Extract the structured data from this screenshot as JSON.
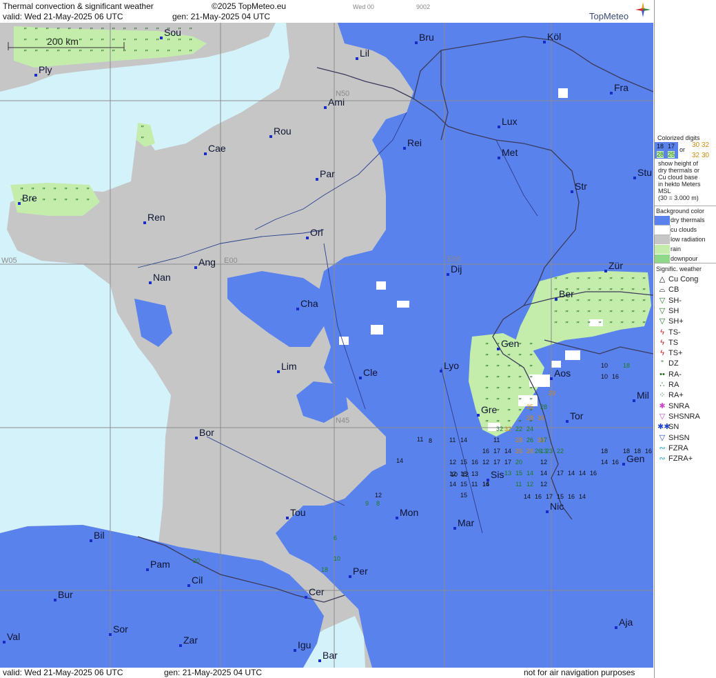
{
  "header": {
    "product_title": "Thermal convection & significant weather",
    "copyright": "©2025 TopMeteo.eu",
    "valid_line": "valid:  Wed  21-May-2025  06 UTC",
    "gen_line": "gen: 21-May-2025 04 UTC",
    "small_code_a": "Wed 00",
    "small_code_b": "9002",
    "brand": "TopMeteo"
  },
  "footer": {
    "valid_line": "valid:  Wed  21-May-2025  06 UTC",
    "gen_line": "gen: 21-May-2025 04 UTC",
    "disclaimer": "not for air navigation purposes"
  },
  "map": {
    "scale_label": "200 km",
    "grid_labels": [
      "N50",
      "N45",
      "W05",
      "E00",
      "E05"
    ],
    "colors": {
      "sea": "#d4f2fa",
      "dry_thermals": "#5a82ec",
      "low_radiation": "#c6c6c6",
      "rain": "#c4edac",
      "cu_clouds": "#ffffff",
      "downpour": "#8fd88a",
      "border": "#3a3a5a",
      "river": "#2b3f8c",
      "grid": "#8c8c8c"
    },
    "cities": [
      {
        "name": "Sou"
      },
      {
        "name": "Ply"
      },
      {
        "name": "Lil"
      },
      {
        "name": "Bru"
      },
      {
        "name": "Köl"
      },
      {
        "name": "Ami"
      },
      {
        "name": "Fra"
      },
      {
        "name": "Rou"
      },
      {
        "name": "Lux"
      },
      {
        "name": "Cae"
      },
      {
        "name": "Rei"
      },
      {
        "name": "Met"
      },
      {
        "name": "Par"
      },
      {
        "name": "Stu"
      },
      {
        "name": "Bre"
      },
      {
        "name": "Str"
      },
      {
        "name": "Ren"
      },
      {
        "name": "Orl"
      },
      {
        "name": "Ang"
      },
      {
        "name": "Dij"
      },
      {
        "name": "Zür"
      },
      {
        "name": "Nan"
      },
      {
        "name": "Ber"
      },
      {
        "name": "Cha"
      },
      {
        "name": "Gen"
      },
      {
        "name": "Lim"
      },
      {
        "name": "Cle"
      },
      {
        "name": "Lyo"
      },
      {
        "name": "Aos"
      },
      {
        "name": "Mil"
      },
      {
        "name": "Gre"
      },
      {
        "name": "Tor"
      },
      {
        "name": "Bor"
      },
      {
        "name": "Gen"
      },
      {
        "name": "Sis"
      },
      {
        "name": "Tou"
      },
      {
        "name": "Mon"
      },
      {
        "name": "Nic"
      },
      {
        "name": "Mar"
      },
      {
        "name": "Bil"
      },
      {
        "name": "Per"
      },
      {
        "name": "Pam"
      },
      {
        "name": "Cil"
      },
      {
        "name": "Cer"
      },
      {
        "name": "Bur"
      },
      {
        "name": "Sor"
      },
      {
        "name": "Aja"
      },
      {
        "name": "Val"
      },
      {
        "name": "Zar"
      },
      {
        "name": "Igu"
      },
      {
        "name": "Bar"
      }
    ],
    "height_digits": [
      {
        "v": "11"
      },
      {
        "v": "8"
      },
      {
        "v": "14"
      },
      {
        "v": "11"
      },
      {
        "v": "14"
      },
      {
        "v": "12"
      },
      {
        "v": "15"
      },
      {
        "v": "16"
      },
      {
        "v": "12"
      },
      {
        "v": "12"
      },
      {
        "v": "15"
      },
      {
        "v": "13"
      },
      {
        "v": "10"
      },
      {
        "v": "12"
      },
      {
        "v": "14"
      },
      {
        "v": "15"
      },
      {
        "v": "11"
      },
      {
        "v": "14"
      },
      {
        "v": "15"
      },
      {
        "v": "16"
      },
      {
        "v": "11"
      },
      {
        "v": "17"
      },
      {
        "v": "14"
      },
      {
        "v": "16"
      },
      {
        "v": "17"
      },
      {
        "v": "17"
      },
      {
        "v": "20"
      },
      {
        "v": "13"
      },
      {
        "v": "15"
      },
      {
        "v": "14"
      },
      {
        "v": "11"
      },
      {
        "v": "12"
      },
      {
        "v": "9"
      },
      {
        "v": "8"
      },
      {
        "v": "10"
      },
      {
        "v": "6"
      },
      {
        "v": "18"
      },
      {
        "v": "20"
      },
      {
        "v": "17"
      },
      {
        "v": "13"
      },
      {
        "v": "12"
      },
      {
        "v": "14"
      },
      {
        "v": "12"
      },
      {
        "v": "17"
      },
      {
        "v": "14"
      },
      {
        "v": "14"
      },
      {
        "v": "16"
      },
      {
        "v": "18"
      },
      {
        "v": "14"
      },
      {
        "v": "16"
      },
      {
        "v": "18"
      },
      {
        "v": "18"
      },
      {
        "v": "16"
      },
      {
        "v": "12"
      },
      {
        "v": "14"
      },
      {
        "v": "16"
      },
      {
        "v": "17"
      },
      {
        "v": "15"
      },
      {
        "v": "16"
      },
      {
        "v": "14"
      },
      {
        "v": "10"
      },
      {
        "v": "10"
      },
      {
        "v": "16"
      },
      {
        "v": "18"
      },
      {
        "v": "28"
      },
      {
        "v": "32"
      },
      {
        "v": "22"
      },
      {
        "v": "24"
      },
      {
        "v": "26"
      },
      {
        "v": "26"
      },
      {
        "v": "23"
      },
      {
        "v": "22"
      }
    ],
    "hatched_digits": [
      {
        "v": "25"
      },
      {
        "v": "32"
      },
      {
        "v": "30"
      },
      {
        "v": "26"
      },
      {
        "v": "28"
      },
      {
        "v": "30"
      },
      {
        "v": "29"
      },
      {
        "v": "28"
      },
      {
        "v": "26"
      }
    ]
  },
  "legend": {
    "colorized_title": "Colorized digits",
    "sample_a": "18",
    "sample_b": "17",
    "sample_c": "28",
    "sample_d": "25",
    "or": "or",
    "sample_e": "30",
    "sample_f": "32",
    "sample_g": "32",
    "sample_h": "30",
    "explain_1": "show height of",
    "explain_2": "dry thermals or",
    "explain_3": "Cu cloud base",
    "explain_4": "in hekto Meters",
    "explain_5": "MSL",
    "explain_6": "(30 = 3.000 m)",
    "bg_title": "Background color",
    "bg_items": [
      {
        "label": "dry thermals",
        "color": "#5a82ec"
      },
      {
        "label": "cu clouds",
        "color": "#ffffff"
      },
      {
        "label": "low radiation",
        "color": "#c6c6c6"
      },
      {
        "label": "rain",
        "color": "#c4edac"
      },
      {
        "label": "downpour",
        "color": "#8fd88a"
      }
    ],
    "sw_title": "Signific. weather",
    "sw_items": [
      {
        "label": "Cu Cong",
        "icon": "cu-cong-icon",
        "glyph": "△",
        "color": "#111111"
      },
      {
        "label": "CB",
        "icon": "cb-icon",
        "glyph": "⌓",
        "color": "#111111"
      },
      {
        "label": "SH-",
        "icon": "shower-light-icon",
        "glyph": "▽",
        "color": "#1c7a1c"
      },
      {
        "label": "SH",
        "icon": "shower-icon",
        "glyph": "▽",
        "color": "#1c7a1c"
      },
      {
        "label": "SH+",
        "icon": "shower-heavy-icon",
        "glyph": "▽",
        "color": "#1c7a1c"
      },
      {
        "label": "TS-",
        "icon": "thunderstorm-light-icon",
        "glyph": "ϟ",
        "color": "#cc2222"
      },
      {
        "label": "TS",
        "icon": "thunderstorm-icon",
        "glyph": "ϟ",
        "color": "#cc2222"
      },
      {
        "label": "TS+",
        "icon": "thunderstorm-heavy-icon",
        "glyph": "ϟ",
        "color": "#cc2222"
      },
      {
        "label": "DZ",
        "icon": "drizzle-icon",
        "glyph": "”",
        "color": "#1c6a1c"
      },
      {
        "label": "RA-",
        "icon": "rain-light-icon",
        "glyph": "••",
        "color": "#1c6a1c"
      },
      {
        "label": "RA",
        "icon": "rain-icon",
        "glyph": "∴",
        "color": "#1c6a1c"
      },
      {
        "label": "RA+",
        "icon": "rain-heavy-icon",
        "glyph": "⁘",
        "color": "#1c6a1c"
      },
      {
        "label": "SNRA",
        "icon": "snow-rain-icon",
        "glyph": "✱",
        "color": "#cc44cc"
      },
      {
        "label": "SHSNRA",
        "icon": "snow-rain-shower-icon",
        "glyph": "▽",
        "color": "#cc44cc"
      },
      {
        "label": "SN",
        "icon": "snow-icon",
        "glyph": "✱✱",
        "color": "#2244cc"
      },
      {
        "label": "SHSN",
        "icon": "snow-shower-icon",
        "glyph": "▽",
        "color": "#2244cc"
      },
      {
        "label": "FZRA",
        "icon": "freezing-rain-icon",
        "glyph": "∾",
        "color": "#22aacc"
      },
      {
        "label": "FZRA+",
        "icon": "freezing-rain-heavy-icon",
        "glyph": "∾",
        "color": "#22aacc"
      }
    ]
  }
}
